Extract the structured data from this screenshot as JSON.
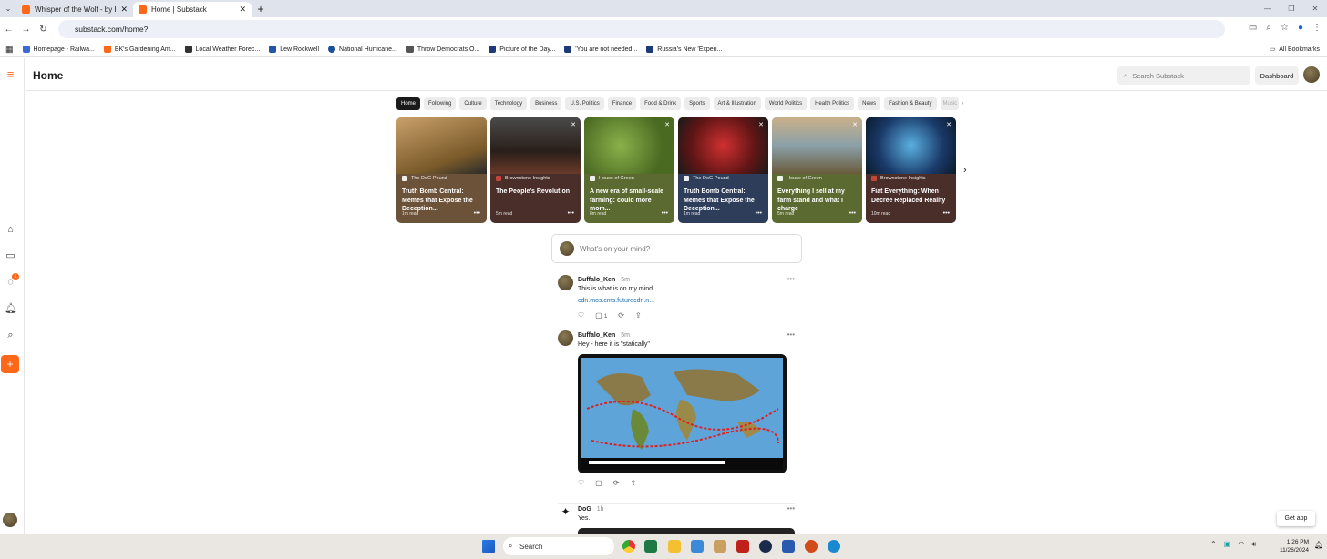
{
  "browser": {
    "tabs": [
      {
        "title": "Whisper of the Wolf - by Buffalo",
        "active": false
      },
      {
        "title": "Home | Substack",
        "active": true
      }
    ],
    "url": "substack.com/home?",
    "bookmarks": [
      {
        "label": "Homepage - Railwa...",
        "color": "#3a6ad9"
      },
      {
        "label": "BK's Gardening Am...",
        "color": "#ff6719"
      },
      {
        "label": "Local Weather Forec...",
        "color": "#333"
      },
      {
        "label": "Lew Rockwell",
        "color": "#2255aa"
      },
      {
        "label": "National Hurricane...",
        "color": "#1b4f9a"
      },
      {
        "label": "Throw Democrats O...",
        "color": "#555"
      },
      {
        "label": "Picture of the Day...",
        "color": "#1a3a7a"
      },
      {
        "label": "'You are not needed...",
        "color": "#1a3a7a"
      },
      {
        "label": "Russia's New 'Experi...",
        "color": "#1a3a7a"
      }
    ],
    "all_bookmarks": "All Bookmarks"
  },
  "header": {
    "title": "Home",
    "search_placeholder": "Search Substack",
    "dashboard": "Dashboard"
  },
  "categories": [
    "Home",
    "Following",
    "Culture",
    "Technology",
    "Business",
    "U.S. Politics",
    "Finance",
    "Food & Drink",
    "Sports",
    "Art & Illustration",
    "World Politics",
    "Health Politics",
    "News",
    "Fashion & Beauty",
    "Music"
  ],
  "cards": [
    {
      "pub": "The DoG Pound",
      "title": "Truth Bomb Central: Memes that Expose the Deception...",
      "read": "1m read",
      "bg": "#6b5238",
      "img": "#b88a3c"
    },
    {
      "pub": "Brownstone Insights",
      "title": "The People's Revolution",
      "read": "5m read",
      "bg": "#4a2e2a",
      "img": "#3a2a22"
    },
    {
      "pub": "House of Green",
      "title": "A new era of small-scale farming: could more mom...",
      "read": "8m read",
      "bg": "#5a6a30",
      "img": "#6a8a3a"
    },
    {
      "pub": "The DoG Pound",
      "title": "Truth Bomb Central: Memes that Expose the Deception...",
      "read": "1m read",
      "bg": "#2e3e5a",
      "img": "#a02020"
    },
    {
      "pub": "House of Green",
      "title": "Everything I sell at my farm stand and what I charge",
      "read": "5m read",
      "bg": "#5a6a30",
      "img": "#9aa6a8"
    },
    {
      "pub": "Brownstone Insights",
      "title": "Fiat Everything: When Decree Replaced Reality",
      "read": "10m read",
      "bg": "#4a2e2a",
      "img": "#1a4a7a"
    }
  ],
  "compose_placeholder": "What's on your mind?",
  "posts": [
    {
      "author": "Buffalo_Ken",
      "ago": "5m",
      "text": "This is what is on my mind.",
      "link": "cdn.mos.cms.futurecdn.n...",
      "comments": "1"
    },
    {
      "author": "Buffalo_Ken",
      "ago": "5m",
      "text": "Hey - here it is \"statically\""
    },
    {
      "author": "DoG",
      "ago": "1h",
      "text": "Yes."
    }
  ],
  "get_app": "Get app",
  "notification_count": "1",
  "taskbar": {
    "search": "Search",
    "time": "1:26 PM",
    "date": "11/26/2024"
  }
}
